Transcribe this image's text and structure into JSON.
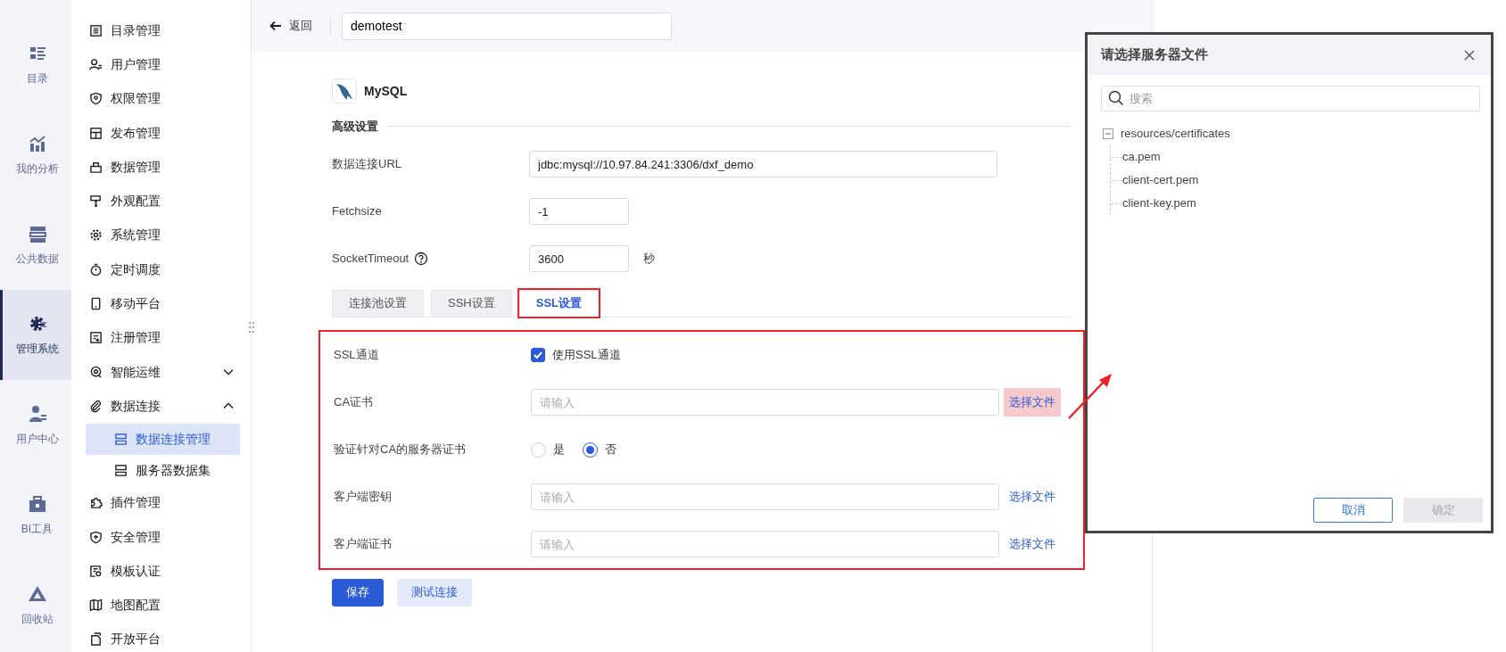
{
  "rail": [
    {
      "label": "目录",
      "selected": false
    },
    {
      "label": "我的分析",
      "selected": false
    },
    {
      "label": "公共数据",
      "selected": false
    },
    {
      "label": "管理系统",
      "selected": true
    },
    {
      "label": "用户中心",
      "selected": false
    },
    {
      "label": "BI工具",
      "selected": false
    },
    {
      "label": "回收站",
      "selected": false
    }
  ],
  "menu": [
    {
      "label": "目录管理",
      "selected": false
    },
    {
      "label": "用户管理",
      "selected": false
    },
    {
      "label": "权限管理",
      "selected": false
    },
    {
      "label": "发布管理",
      "selected": false
    },
    {
      "label": "数据管理",
      "selected": false
    },
    {
      "label": "外观配置",
      "selected": false
    },
    {
      "label": "系统管理",
      "selected": false
    },
    {
      "label": "定时调度",
      "selected": false
    },
    {
      "label": "移动平台",
      "selected": false
    },
    {
      "label": "注册管理",
      "selected": false
    },
    {
      "label": "智能运维",
      "selected": false,
      "expanded": false
    },
    {
      "label": "数据连接",
      "selected": false,
      "expanded": true,
      "children": [
        {
          "label": "数据连接管理",
          "selected": true
        },
        {
          "label": "服务器数据集",
          "selected": false
        }
      ]
    },
    {
      "label": "插件管理",
      "selected": false
    },
    {
      "label": "安全管理",
      "selected": false
    },
    {
      "label": "模板认证",
      "selected": false
    },
    {
      "label": "地图配置",
      "selected": false
    },
    {
      "label": "开放平台",
      "selected": false
    }
  ],
  "topbar": {
    "back": "返回",
    "name": "demotest"
  },
  "connector": {
    "name": "MySQL"
  },
  "section_title": "高级设置",
  "fields": [
    {
      "label": "数据连接URL",
      "value": "jdbc:mysql://10.97.84.241:3306/dxf_demo",
      "kind": "long"
    },
    {
      "label": "Fetchsize",
      "value": "-1",
      "kind": "short"
    },
    {
      "label": "SocketTimeout",
      "value": "3600",
      "kind": "short",
      "help": true,
      "unit": "秒"
    }
  ],
  "tabs": [
    {
      "label": "连接池设置",
      "selected": false,
      "highlighted": false
    },
    {
      "label": "SSH设置",
      "selected": false,
      "highlighted": false
    },
    {
      "label": "SSL设置",
      "selected": true,
      "highlighted": true
    }
  ],
  "ssl": {
    "highlighted": true,
    "rows": [
      {
        "kind": "checkbox",
        "label": "SSL通道",
        "option": "使用SSL通道",
        "checked": true
      },
      {
        "kind": "file",
        "label": "CA证书",
        "placeholder": "请输入",
        "action": "选择文件",
        "highlighted": true
      },
      {
        "kind": "radio",
        "label": "验证针对CA的服务器证书",
        "options": [
          {
            "label": "是",
            "selected": false
          },
          {
            "label": "否",
            "selected": true
          }
        ]
      },
      {
        "kind": "file",
        "label": "客户端密钥",
        "placeholder": "请输入",
        "action": "选择文件",
        "highlighted": false
      },
      {
        "kind": "file",
        "label": "客户端证书",
        "placeholder": "请输入",
        "action": "选择文件",
        "highlighted": false
      }
    ]
  },
  "buttons": [
    {
      "label": "保存",
      "kind": "primary"
    },
    {
      "label": "测试连接",
      "kind": "secondary"
    }
  ],
  "dialog": {
    "title": "请选择服务器文件",
    "search_placeholder": "搜索",
    "tree": [
      {
        "label": "resources/certificates",
        "expanded": true,
        "children": [
          {
            "label": "ca.pem"
          },
          {
            "label": "client-cert.pem"
          },
          {
            "label": "client-key.pem"
          }
        ]
      }
    ],
    "buttons": [
      {
        "label": "取消",
        "disabled": false
      },
      {
        "label": "确定",
        "disabled": true
      }
    ]
  }
}
